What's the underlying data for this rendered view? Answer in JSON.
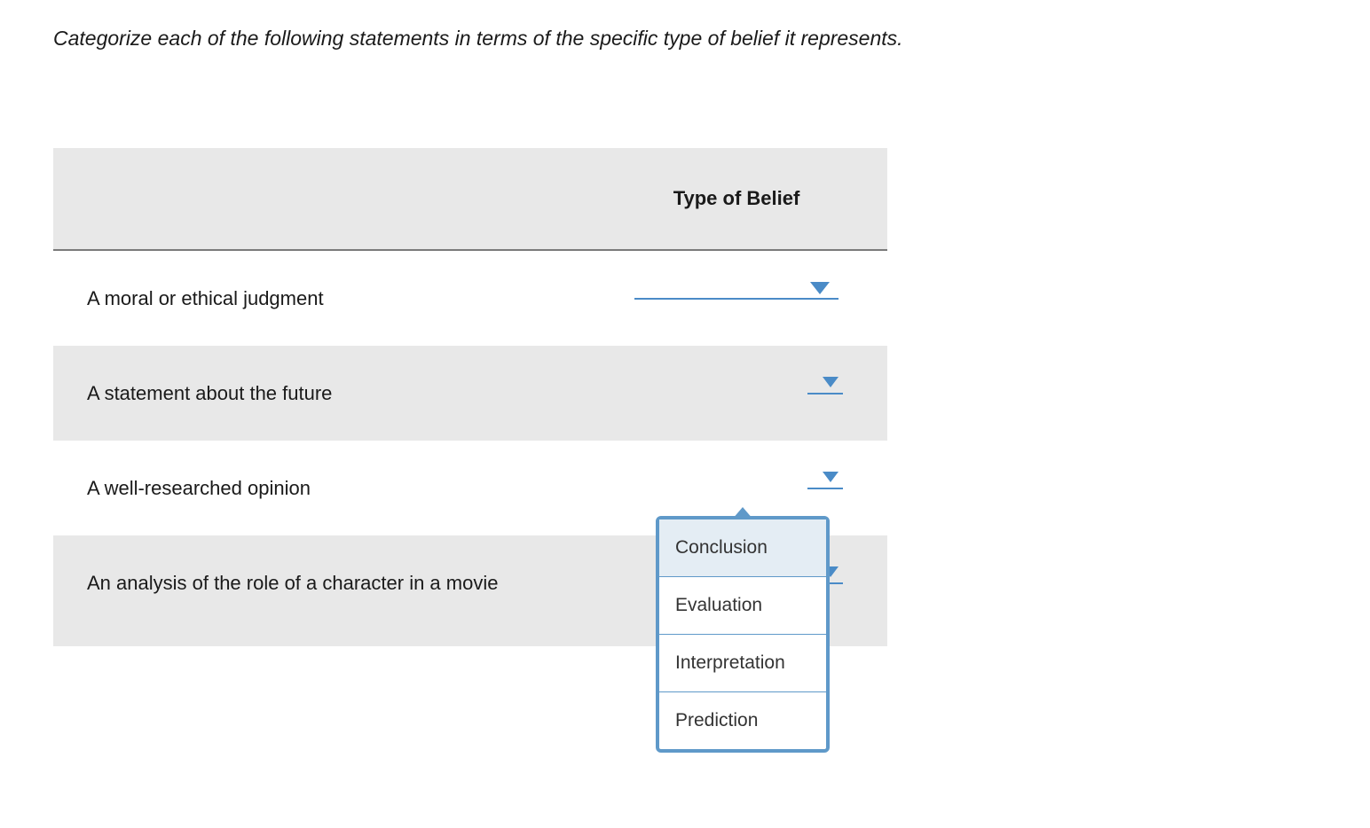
{
  "question": {
    "prompt": "Categorize each of the following statements in terms of the specific type of belief it represents."
  },
  "table": {
    "header": {
      "col2": "Type of Belief"
    },
    "rows": [
      {
        "label": "A moral or ethical judgment"
      },
      {
        "label": "A statement about the future"
      },
      {
        "label": "A well-researched opinion"
      },
      {
        "label": "An analysis of the role of a character in a movie"
      }
    ]
  },
  "dropdown": {
    "options": [
      {
        "label": "Conclusion",
        "highlighted": true
      },
      {
        "label": "Evaluation",
        "highlighted": false
      },
      {
        "label": "Interpretation",
        "highlighted": false
      },
      {
        "label": "Prediction",
        "highlighted": false
      }
    ]
  }
}
